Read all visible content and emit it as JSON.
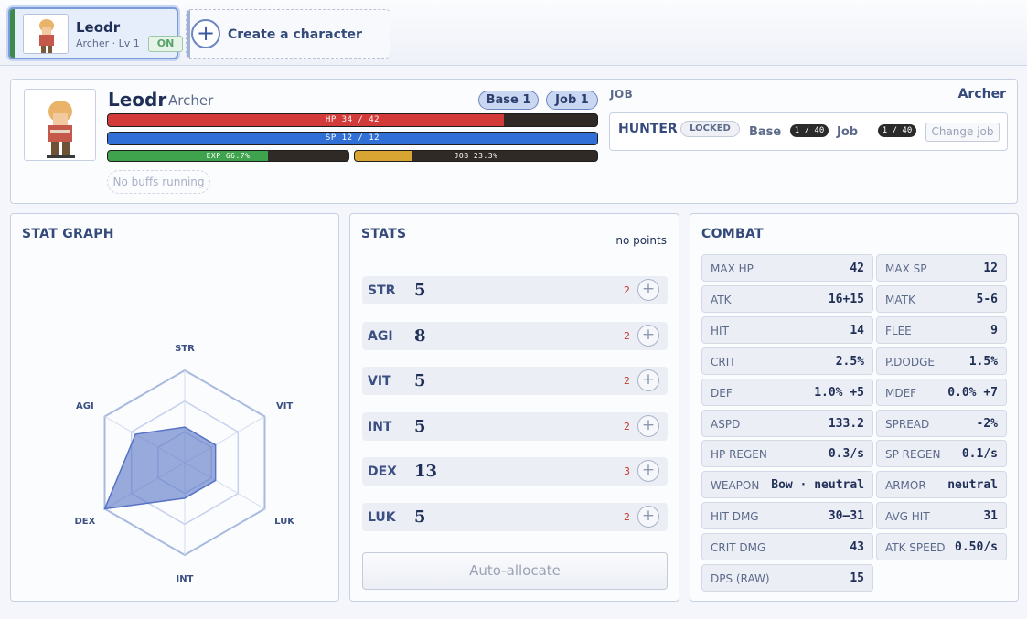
{
  "tabs": {
    "character": {
      "name": "Leodr",
      "sub": "Archer · Lv 1",
      "status": "ON"
    },
    "create_label": "Create a character"
  },
  "header": {
    "name": "Leodr",
    "class": "Archer",
    "base_badge": "Base 1",
    "job_badge": "Job 1",
    "hp": {
      "text": "HP 34 / 42",
      "current": 34,
      "max": 42,
      "color": "#d33a3a"
    },
    "sp": {
      "text": "SP 12 / 12",
      "current": 12,
      "max": 12,
      "color": "#2f6fd6"
    },
    "exp": {
      "text": "EXP 66.7%",
      "percent": 66.7,
      "color": "#3fa34d"
    },
    "job_exp": {
      "text": "JOB 23.3%",
      "percent": 23.3,
      "color": "#d9a532"
    },
    "buffs": "No buffs running"
  },
  "job": {
    "label": "JOB",
    "current": "Archer",
    "next": "HUNTER",
    "locked": "LOCKED",
    "base_label": "Base",
    "base_req": "1 / 40",
    "job_label": "Job",
    "job_req": "1 / 40",
    "change_label": "Change job"
  },
  "graph": {
    "title": "STAT GRAPH",
    "labels": [
      "STR",
      "VIT",
      "LUK",
      "INT",
      "DEX",
      "AGI"
    ],
    "values": [
      5,
      5,
      5,
      5,
      13,
      8
    ],
    "max": 13
  },
  "stats": {
    "title": "STATS",
    "points": "no points",
    "rows": [
      {
        "name": "STR",
        "value": "5",
        "cost": "2"
      },
      {
        "name": "AGI",
        "value": "8",
        "cost": "2"
      },
      {
        "name": "VIT",
        "value": "5",
        "cost": "2"
      },
      {
        "name": "INT",
        "value": "5",
        "cost": "2"
      },
      {
        "name": "DEX",
        "value": "13",
        "cost": "3"
      },
      {
        "name": "LUK",
        "value": "5",
        "cost": "2"
      }
    ],
    "plus": "+",
    "auto_label": "Auto-allocate"
  },
  "combat": {
    "title": "COMBAT",
    "left": [
      {
        "k": "MAX HP",
        "v": "42"
      },
      {
        "k": "ATK",
        "v": "16+15"
      },
      {
        "k": "HIT",
        "v": "14"
      },
      {
        "k": "CRIT",
        "v": "2.5%"
      },
      {
        "k": "DEF",
        "v": "1.0% +5"
      },
      {
        "k": "ASPD",
        "v": "133.2"
      },
      {
        "k": "HP REGEN",
        "v": "0.3/s"
      },
      {
        "k": "WEAPON",
        "v": "Bow · neutral"
      },
      {
        "k": "HIT DMG",
        "v": "30–31"
      },
      {
        "k": "CRIT DMG",
        "v": "43"
      },
      {
        "k": "DPS (RAW)",
        "v": "15"
      }
    ],
    "right": [
      {
        "k": "MAX SP",
        "v": "12"
      },
      {
        "k": "MATK",
        "v": "5-6"
      },
      {
        "k": "FLEE",
        "v": "9"
      },
      {
        "k": "P.DODGE",
        "v": "1.5%"
      },
      {
        "k": "MDEF",
        "v": "0.0% +7"
      },
      {
        "k": "SPREAD",
        "v": "-2%"
      },
      {
        "k": "SP REGEN",
        "v": "0.1/s"
      },
      {
        "k": "ARMOR",
        "v": "neutral"
      },
      {
        "k": "AVG HIT",
        "v": "31"
      },
      {
        "k": "ATK SPEED",
        "v": "0.50/s"
      }
    ]
  }
}
